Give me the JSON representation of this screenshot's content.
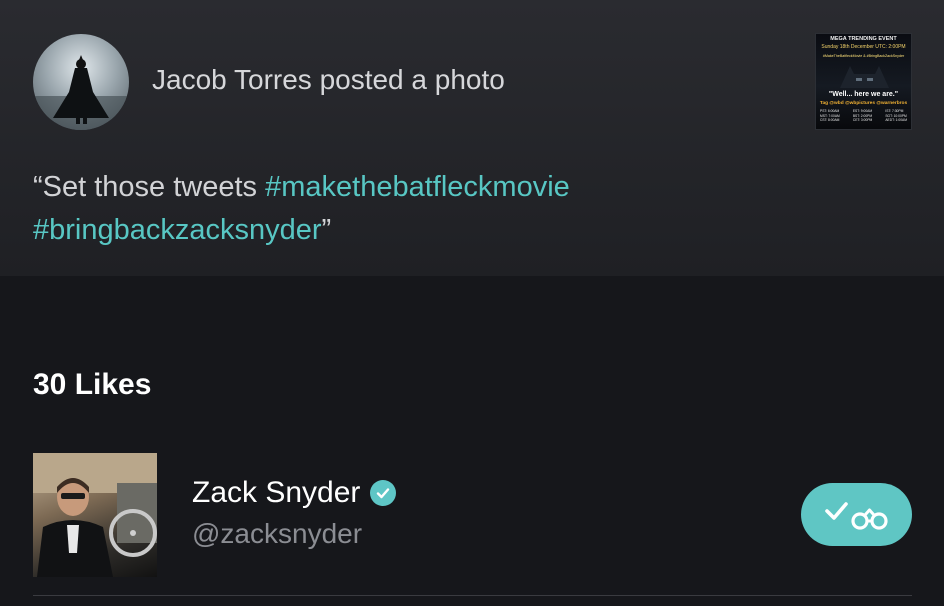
{
  "post": {
    "author_line": "Jacob Torres posted a photo",
    "caption_open_quote": "“Set those tweets ",
    "hashtag_1": "#makethebatfleckmovie",
    "hashtag_2": "#bringbackzacksnyder",
    "caption_close_quote": "”",
    "thumbnail": {
      "title": "MEGA TRENDING EVENT",
      "date": "Sunday 18th December UTC: 2:00PM",
      "tags": "#MakeTheBatfleckMovie & #BringBackZackSnyder",
      "quote": "\"Well... here we are.\"",
      "tagline": "Tag @wbd @wbpictures @warnerbros",
      "times_col1": [
        "PST: 6:00AM",
        "MST: 7:00AM",
        "CST: 8:00AM"
      ],
      "times_col2": [
        "EST: 9:00AM",
        "BST: 2:00PM",
        "CET: 3:00PM"
      ],
      "times_col3": [
        "IST: 7:30PM",
        "SGT: 10:00PM",
        "AEDT: 1:00AM"
      ]
    }
  },
  "likes": {
    "heading": "30 Likes",
    "users": [
      {
        "name": "Zack Snyder",
        "handle": "@zacksnyder",
        "verified": true
      }
    ]
  },
  "colors": {
    "accent": "#58c7c4",
    "background": "#16171b",
    "card": "#2a2b30"
  },
  "icons": {
    "verified": "verified-check-icon",
    "follow": "check-binoculars-icon"
  }
}
